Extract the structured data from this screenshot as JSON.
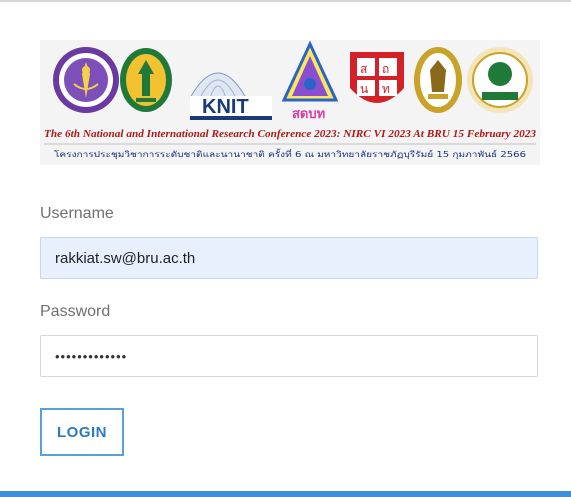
{
  "banner": {
    "title_en": "The 6th National and International Research Conference 2023: NIRC VI 2023 At BRU 15 February 2023",
    "title_th": "โครงการประชุมวิชาการระดับชาติและนานาชาติ ครั้งที่ 6 ณ มหาวิทยาลัยราชภัฏบุรีรัมย์ 15 กุมภาพันธ์ 2566",
    "logo_knit_text": "KNIT",
    "logo_sdbt_text": "สดบท",
    "logo_red_chars": [
      "ส",
      "ถ",
      "น",
      "ท"
    ],
    "colors": {
      "title_en": "#b01818",
      "title_th": "#1a2e7a",
      "logo_purple": "#6a3aa0",
      "logo_green": "#1f7a3a",
      "logo_red": "#d42027",
      "logo_gold": "#c9a227"
    }
  },
  "form": {
    "username_label": "Username",
    "username_value": "rakkiat.sw@bru.ac.th",
    "password_label": "Password",
    "password_value": "•••••••••••••",
    "login_label": "LOGIN"
  },
  "colors": {
    "accent": "#2b7bc0",
    "autofill_bg": "#e8f0fe",
    "bottom_bar": "#3d8fd8"
  }
}
